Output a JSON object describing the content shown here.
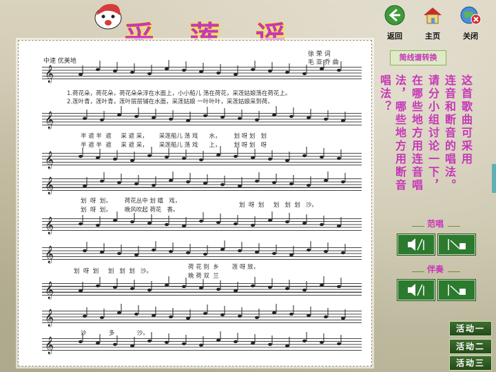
{
  "title": "采 莲 谣",
  "nav": [
    {
      "label": "返回",
      "icon": "back-arrow-icon"
    },
    {
      "label": "主页",
      "icon": "home-icon"
    },
    {
      "label": "关闭",
      "icon": "close-icon"
    }
  ],
  "score": {
    "tempo": "中速  优美地",
    "lyricist": "徐 荣 词",
    "composer": "毛 亚 乔 曲",
    "verse1": "1.荷花朵，荷花朵，荷花朵朵浮在水面上，小小船儿 荡在荷花，采莲姑娘荡在荷花上。",
    "verse2": "2.莲叶青，莲叶青，莲叶层层铺在水面，采莲姑娘 一叶叶叶，采莲姑娘采到荷。",
    "lyrics_a1": "半 遮 半  遮     采 遮 采，      采莲船儿 荡 戏      水，       划 呀 划   划",
    "lyrics_a2": "半 遮 半  遮     采 遮 采，      采莲船儿 荡 戏      上，       划 呀 划   呀",
    "lyrics_b1": "划  呀  划，       荷花丛中 划 嬉   戏，",
    "lyrics_b2": "划  呀  划，       晚风吹起 荷花   香。",
    "lyrics_b3": "划  呀  划     划   划  划   沙。",
    "lyrics_c1": "划  呀  划     划   划  划   沙。",
    "lyrics_c2": "荷 花 别  乡       莲 呀 放，",
    "lyrics_c3": "晚 荷 双  兰",
    "lyrics_d": "沙            多            沙。"
  },
  "convert_button": "简线谱转换",
  "question_columns": [
    "这首歌曲可采用",
    "连音和断音的唱法。",
    "请分小组讨论一下，",
    "在哪些地方用连音唱",
    "法，哪些地方用断音",
    "唱法？"
  ],
  "sections": [
    {
      "label": "范唱",
      "play_icon": "speaker-play-icon",
      "stop_icon": "stop-icon"
    },
    {
      "label": "伴奏",
      "play_icon": "speaker-play-icon",
      "stop_icon": "stop-icon"
    }
  ],
  "activities": [
    "活动一",
    "活动二",
    "活动三"
  ],
  "colors": {
    "accent": "#c637b7",
    "green": "#2c7a2e"
  }
}
